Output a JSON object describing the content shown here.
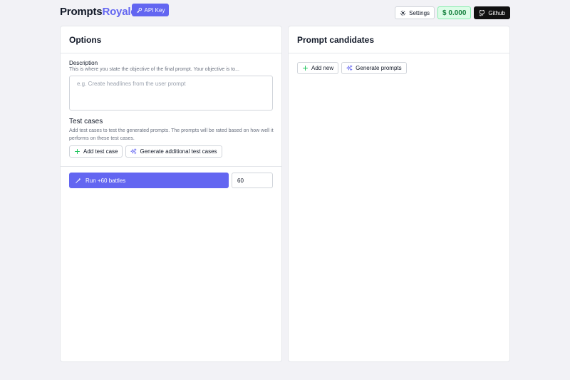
{
  "brand": {
    "part1": "Prompts",
    "part2": "Royale"
  },
  "header": {
    "api_key_label": "API Key",
    "settings_label": "Settings",
    "balance": "$ 0.000",
    "github_label": "Github"
  },
  "options": {
    "title": "Options",
    "description": {
      "label": "Description",
      "help": "This is where you state the objective of the final prompt. Your objective is to...",
      "placeholder": "e.g. Create headlines from the user prompt",
      "value": ""
    },
    "test_cases": {
      "title": "Test cases",
      "help": "Add test cases to test the generated prompts. The prompts will be rated based on how well it performs on these test cases.",
      "add_label": "Add test case",
      "generate_label": "Generate additional test cases"
    },
    "run": {
      "label": "Run +60 battles",
      "battles_value": "60"
    }
  },
  "candidates": {
    "title": "Prompt candidates",
    "add_label": "Add new",
    "generate_label": "Generate prompts"
  },
  "colors": {
    "accent": "#6366f1",
    "balance_bg": "#dcfce7",
    "balance_text": "#15803d",
    "github_bg": "#111111"
  }
}
